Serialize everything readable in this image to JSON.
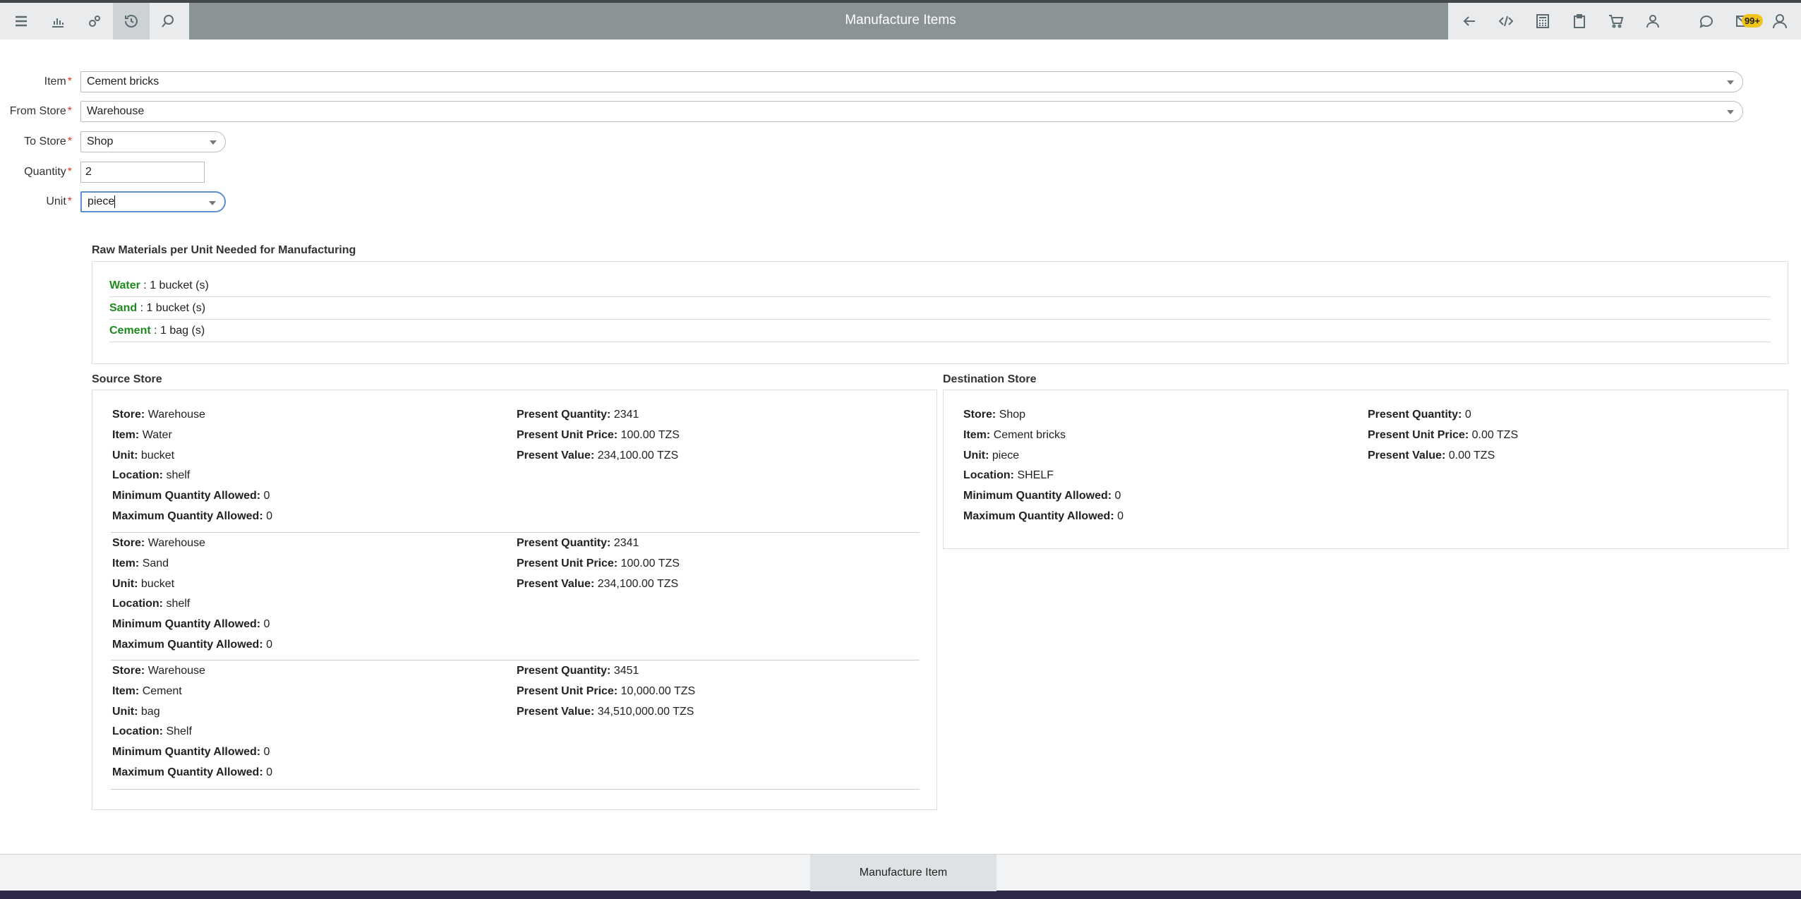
{
  "header": {
    "title": "Manufacture Items",
    "notification_count": "99+",
    "left_icons": [
      "menu-icon",
      "chart-icon",
      "settings-icon",
      "history-icon",
      "search-icon"
    ],
    "right_icons": [
      "back-arrow-icon",
      "code-icon",
      "calculator-icon",
      "clipboard-icon",
      "cart-icon",
      "users-icon",
      "chat-icon",
      "mail-icon",
      "user-icon"
    ]
  },
  "form": {
    "item_label": "Item",
    "item_value": "Cement bricks",
    "from_store_label": "From Store",
    "from_store_value": "Warehouse",
    "to_store_label": "To Store",
    "to_store_value": "Shop",
    "quantity_label": "Quantity",
    "quantity_value": "2",
    "unit_label": "Unit",
    "unit_value": "piece",
    "required_mark": "*"
  },
  "raw_materials": {
    "title": "Raw Materials per Unit Needed for Manufacturing",
    "items": [
      {
        "name": "Water",
        "amount": " : 1 bucket (s)"
      },
      {
        "name": "Sand",
        "amount": " : 1 bucket (s)"
      },
      {
        "name": "Cement",
        "amount": " : 1 bag (s)"
      }
    ]
  },
  "labels": {
    "store": "Store:",
    "item": "Item:",
    "unit": "Unit:",
    "location": "Location:",
    "min_qty": "Minimum Quantity Allowed:",
    "max_qty": "Maximum Quantity Allowed:",
    "present_qty": "Present Quantity:",
    "present_unit_price": "Present Unit Price:",
    "present_value": "Present Value:"
  },
  "source_store": {
    "title": "Source Store",
    "entries": [
      {
        "store": "Warehouse",
        "item": "Water",
        "unit": "bucket",
        "location": "shelf",
        "min_qty": "0",
        "max_qty": "0",
        "present_qty": "2341",
        "present_unit_price": "100.00 TZS",
        "present_value": "234,100.00 TZS"
      },
      {
        "store": "Warehouse",
        "item": "Sand",
        "unit": "bucket",
        "location": "shelf",
        "min_qty": "0",
        "max_qty": "0",
        "present_qty": "2341",
        "present_unit_price": "100.00 TZS",
        "present_value": "234,100.00 TZS"
      },
      {
        "store": "Warehouse",
        "item": "Cement",
        "unit": "bag",
        "location": "Shelf",
        "min_qty": "0",
        "max_qty": "0",
        "present_qty": "3451",
        "present_unit_price": "10,000.00 TZS",
        "present_value": "34,510,000.00 TZS"
      }
    ]
  },
  "destination_store": {
    "title": "Destination Store",
    "entry": {
      "store": "Shop",
      "item": "Cement bricks",
      "unit": "piece",
      "location": "SHELF",
      "min_qty": "0",
      "max_qty": "0",
      "present_qty": "0",
      "present_unit_price": "0.00 TZS",
      "present_value": "0.00 TZS"
    }
  },
  "footer": {
    "manufacture_button": "Manufacture Item"
  }
}
